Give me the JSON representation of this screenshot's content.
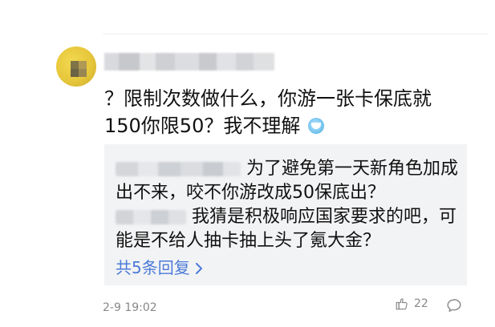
{
  "comment": {
    "text_line1": "？限制次数做什么，你游一张卡保底就",
    "text_line2": "150你限50？我不理解",
    "date": "2-9 19:02",
    "like_count": "22"
  },
  "replies": [
    {
      "line1": "为了避免第一天新角色加成",
      "line2": "出不来，咬不你游改成50保底出？"
    },
    {
      "line1": "我猜是积极响应国家要求的吧，可",
      "line2": "能是不给人抽卡抽上头了氪大金？"
    }
  ],
  "more_replies": "共5条回复",
  "colors": {
    "link": "#4c7bd8",
    "reply_bg": "#f2f3f5"
  },
  "icons": {
    "emoji": "grimace-emoji-icon",
    "like": "thumbs-up-icon",
    "comment": "comment-bubble-icon",
    "more": "chevron-right-icon"
  }
}
